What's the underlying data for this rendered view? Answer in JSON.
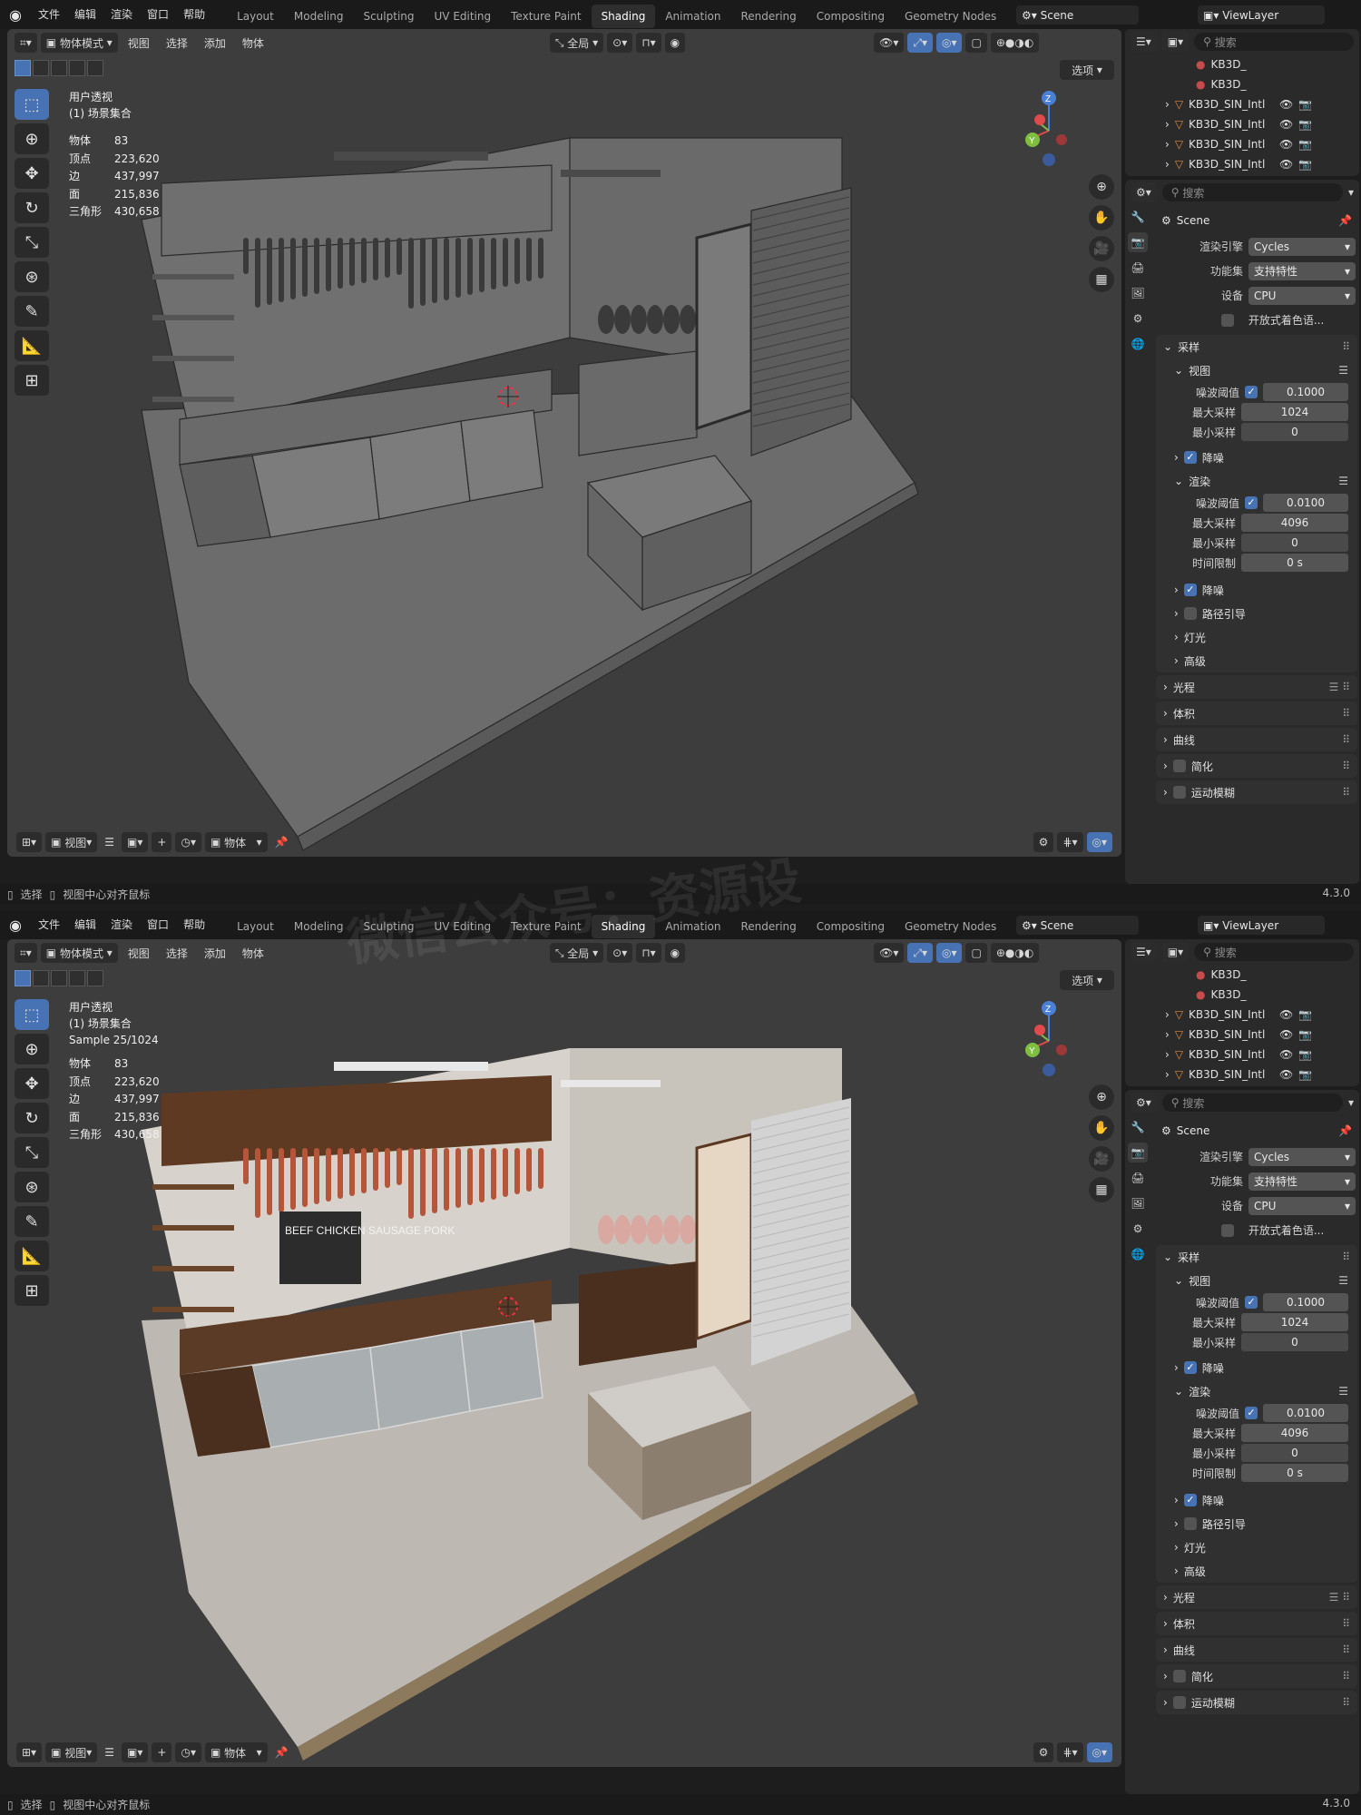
{
  "menu": {
    "file": "文件",
    "edit": "编辑",
    "render": "渲染",
    "window": "窗口",
    "help": "帮助"
  },
  "workspaces": [
    "Layout",
    "Modeling",
    "Sculpting",
    "UV Editing",
    "Texture Paint",
    "Shading",
    "Animation",
    "Rendering",
    "Compositing",
    "Geometry Nodes"
  ],
  "active_workspace": "Shading",
  "scene_name": "Scene",
  "view_layer": "ViewLayer",
  "viewport_header": {
    "mode": "物体模式",
    "view": "视图",
    "select": "选择",
    "add": "添加",
    "object": "物体",
    "transform_orientation": "全局"
  },
  "options_label": "选项",
  "overlay": {
    "view_name": "用户透视",
    "collection": "(1) 场景集合",
    "sample": "Sample 25/1024"
  },
  "stats": [
    {
      "label": "物体",
      "value": "83"
    },
    {
      "label": "顶点",
      "value": "223,620"
    },
    {
      "label": "边",
      "value": "437,997"
    },
    {
      "label": "面",
      "value": "215,836"
    },
    {
      "label": "三角形",
      "value": "430,658"
    }
  ],
  "footer": {
    "view": "视图",
    "object": "物体"
  },
  "statusbar": {
    "select": "选择",
    "center": "视图中心对齐鼠标",
    "version": "4.3.0"
  },
  "outliner": {
    "search_placeholder": "搜索",
    "sub_items": [
      "KB3D_",
      "KB3D_"
    ],
    "items": [
      "KB3D_SIN_Intl",
      "KB3D_SIN_Intl",
      "KB3D_SIN_Intl",
      "KB3D_SIN_Intl",
      "KB3D_SIN_Intl"
    ]
  },
  "properties": {
    "search_placeholder": "搜索",
    "scene_label": "Scene",
    "engine_label": "渲染引擎",
    "engine_value": "Cycles",
    "featureset_label": "功能集",
    "featureset_value": "支持特性",
    "device_label": "设备",
    "device_value": "CPU",
    "osl_label": "开放式着色语...",
    "sampling": "采样",
    "viewport": "视图",
    "noise_threshold": "噪波阈值",
    "vp_noise_value": "0.1000",
    "max_samples": "最大采样",
    "vp_max_value": "1024",
    "min_samples": "最小采样",
    "vp_min_value": "0",
    "denoise": "降噪",
    "render": "渲染",
    "r_noise_value": "0.0100",
    "r_max_value": "4096",
    "r_min_value": "0",
    "time_limit": "时间限制",
    "time_value": "0 s",
    "path_guiding": "路径引导",
    "lights": "灯光",
    "advanced": "高级",
    "light_paths": "光程",
    "volumes": "体积",
    "curves": "曲线",
    "simplify": "简化",
    "motion_blur": "运动模糊"
  },
  "watermark": "微信公众号：资源设",
  "colors": {
    "accent": "#4772b3",
    "background": "#1d1d1d",
    "viewport": "#3d3d3d",
    "panel": "#2a2a2a"
  },
  "scene_signage": {
    "sign_text": "BEEF CHICKEN SAUSAGE PORK"
  }
}
